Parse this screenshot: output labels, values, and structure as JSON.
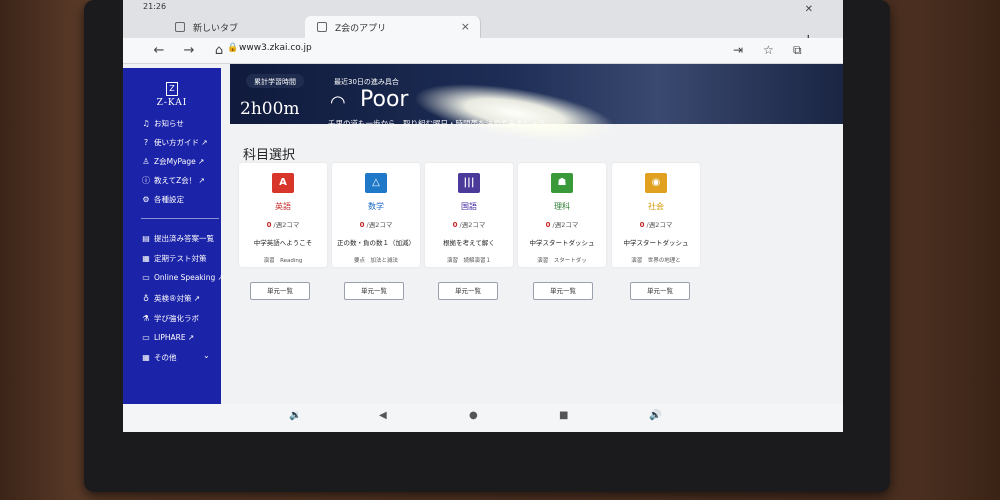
{
  "status": {
    "time": "21:26"
  },
  "tabs": [
    {
      "label": "新しいタブ",
      "active": false
    },
    {
      "label": "Z会のアプリ",
      "active": true
    }
  ],
  "address": {
    "url": "www3.zkai.co.jp"
  },
  "sidebar": {
    "logo": "Z-KAI",
    "logo_mark": "Z",
    "items": [
      {
        "label": "お知らせ",
        "icon": "bell-icon",
        "glyph": "♫"
      },
      {
        "label": "使い方ガイド ↗",
        "icon": "help-icon",
        "glyph": "?"
      },
      {
        "label": "Z会MyPage ↗",
        "icon": "person-icon",
        "glyph": "♙"
      },
      {
        "label": "教えてZ会！ ↗",
        "icon": "info-icon",
        "glyph": "ⓘ"
      },
      {
        "label": "各種設定",
        "icon": "gear-icon",
        "glyph": "⚙"
      },
      {
        "label": "提出済み答案一覧",
        "icon": "document-icon",
        "glyph": "▤"
      },
      {
        "label": "定期テスト対策",
        "icon": "document-icon",
        "glyph": "▦"
      },
      {
        "label": "Online Speaking ↗",
        "icon": "chat-icon",
        "glyph": "▭"
      },
      {
        "label": "英検®対策 ↗",
        "icon": "headset-icon",
        "glyph": "♁"
      },
      {
        "label": "学び強化ラボ",
        "icon": "flask-icon",
        "glyph": "⚗"
      },
      {
        "label": "LIPHARE ↗",
        "icon": "monitor-icon",
        "glyph": "▭"
      },
      {
        "label": "その他",
        "icon": "grid-icon",
        "glyph": "▦"
      }
    ]
  },
  "hero": {
    "total_time_label": "累計学習時間",
    "total_time": "2h00m",
    "recent_label": "最近30日の進み具合",
    "status": "Poor",
    "message": "千里の道も一歩から。取り組む曜日・時間帯を決めてみましょう。"
  },
  "main": {
    "title": "科目選択",
    "unit_button": "単元一覧",
    "subjects": [
      {
        "name": "英語",
        "icon": "english-icon",
        "glyph": "A",
        "color": "#d9362b",
        "name_color": "#c62828",
        "progress_n": "0",
        "progress_suffix": " /週2コマ",
        "unit": "中学英語へようこそ",
        "tag": "演習　Reading"
      },
      {
        "name": "数学",
        "icon": "math-icon",
        "glyph": "△",
        "color": "#1f78c8",
        "name_color": "#1565c0",
        "progress_n": "0",
        "progress_suffix": " /週2コマ",
        "unit": "正の数・負の数１（加減）",
        "tag": "要点　加法と減法"
      },
      {
        "name": "国語",
        "icon": "japanese-icon",
        "glyph": "|||",
        "color": "#4b3a9a",
        "name_color": "#4527a0",
        "progress_n": "0",
        "progress_suffix": " /週2コマ",
        "unit": "根拠を考えて解く",
        "tag": "演習　読解演習１"
      },
      {
        "name": "理科",
        "icon": "science-icon",
        "glyph": "☗",
        "color": "#3a9a3a",
        "name_color": "#2e7d32",
        "progress_n": "0",
        "progress_suffix": " /週2コマ",
        "unit": "中学スタートダッシュ",
        "tag": "演習　スタートダッ"
      },
      {
        "name": "社会",
        "icon": "social-icon",
        "glyph": "◉",
        "color": "#e0a020",
        "name_color": "#d49a12",
        "progress_n": "0",
        "progress_suffix": " /週2コマ",
        "unit": "中学スタートダッシュ",
        "tag": "演習　世界の地理と"
      }
    ]
  }
}
